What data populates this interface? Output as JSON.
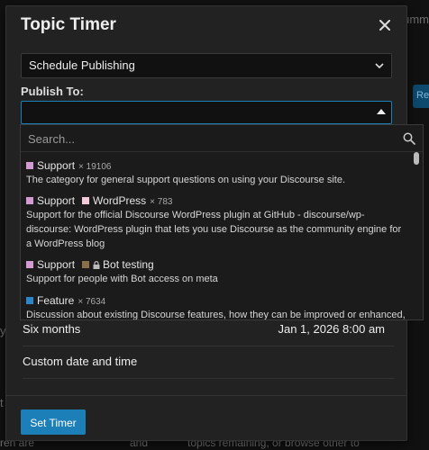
{
  "background": {
    "header_fragment": "Summ",
    "button_fragment": "Re",
    "left_fragment_1": "y",
    "left_fragment_2": "t",
    "bottom_fragments": [
      "ren are",
      "and",
      "topics remaining, or browse other to"
    ]
  },
  "modal": {
    "title": "Topic Timer",
    "close_icon": "close-icon",
    "timer_type": {
      "selected": "Schedule Publishing"
    },
    "publish_to": {
      "label": "Publish To:",
      "value": "",
      "search_placeholder": "Search...",
      "options": [
        {
          "badges": [
            {
              "name": "Support",
              "color": "#d39bd1"
            }
          ],
          "count": "× 19106",
          "description": "The category for general support questions on using your Discourse site."
        },
        {
          "badges": [
            {
              "name": "Support",
              "color": "#d39bd1"
            },
            {
              "name": "WordPress",
              "color": "#f4c9d9"
            }
          ],
          "count": "× 783",
          "description": "Support for the official Discourse WordPress plugin at GitHub - discourse/wp-discourse: WordPress plugin that lets you use Discourse as the community engine for a WordPress blog"
        },
        {
          "badges": [
            {
              "name": "Support",
              "color": "#d39bd1"
            },
            {
              "name": "Bot testing",
              "color": "#8a6f4a",
              "locked": true
            }
          ],
          "count": "",
          "description": "Support for people with Bot access on meta"
        },
        {
          "badges": [
            {
              "name": "Feature",
              "color": "#2a86c9"
            }
          ],
          "count": "× 7634",
          "description": "Discussion about existing Discourse features, how they can be improved or enhanced,"
        }
      ]
    },
    "time_options": [
      {
        "label": "Six months",
        "date": "Jan 1, 2026 8:00 am"
      },
      {
        "label": "Custom date and time",
        "date": ""
      }
    ],
    "submit_label": "Set Timer"
  },
  "colors": {
    "accent": "#1d7fb8",
    "modal_bg": "#222222",
    "page_bg": "#111111"
  }
}
